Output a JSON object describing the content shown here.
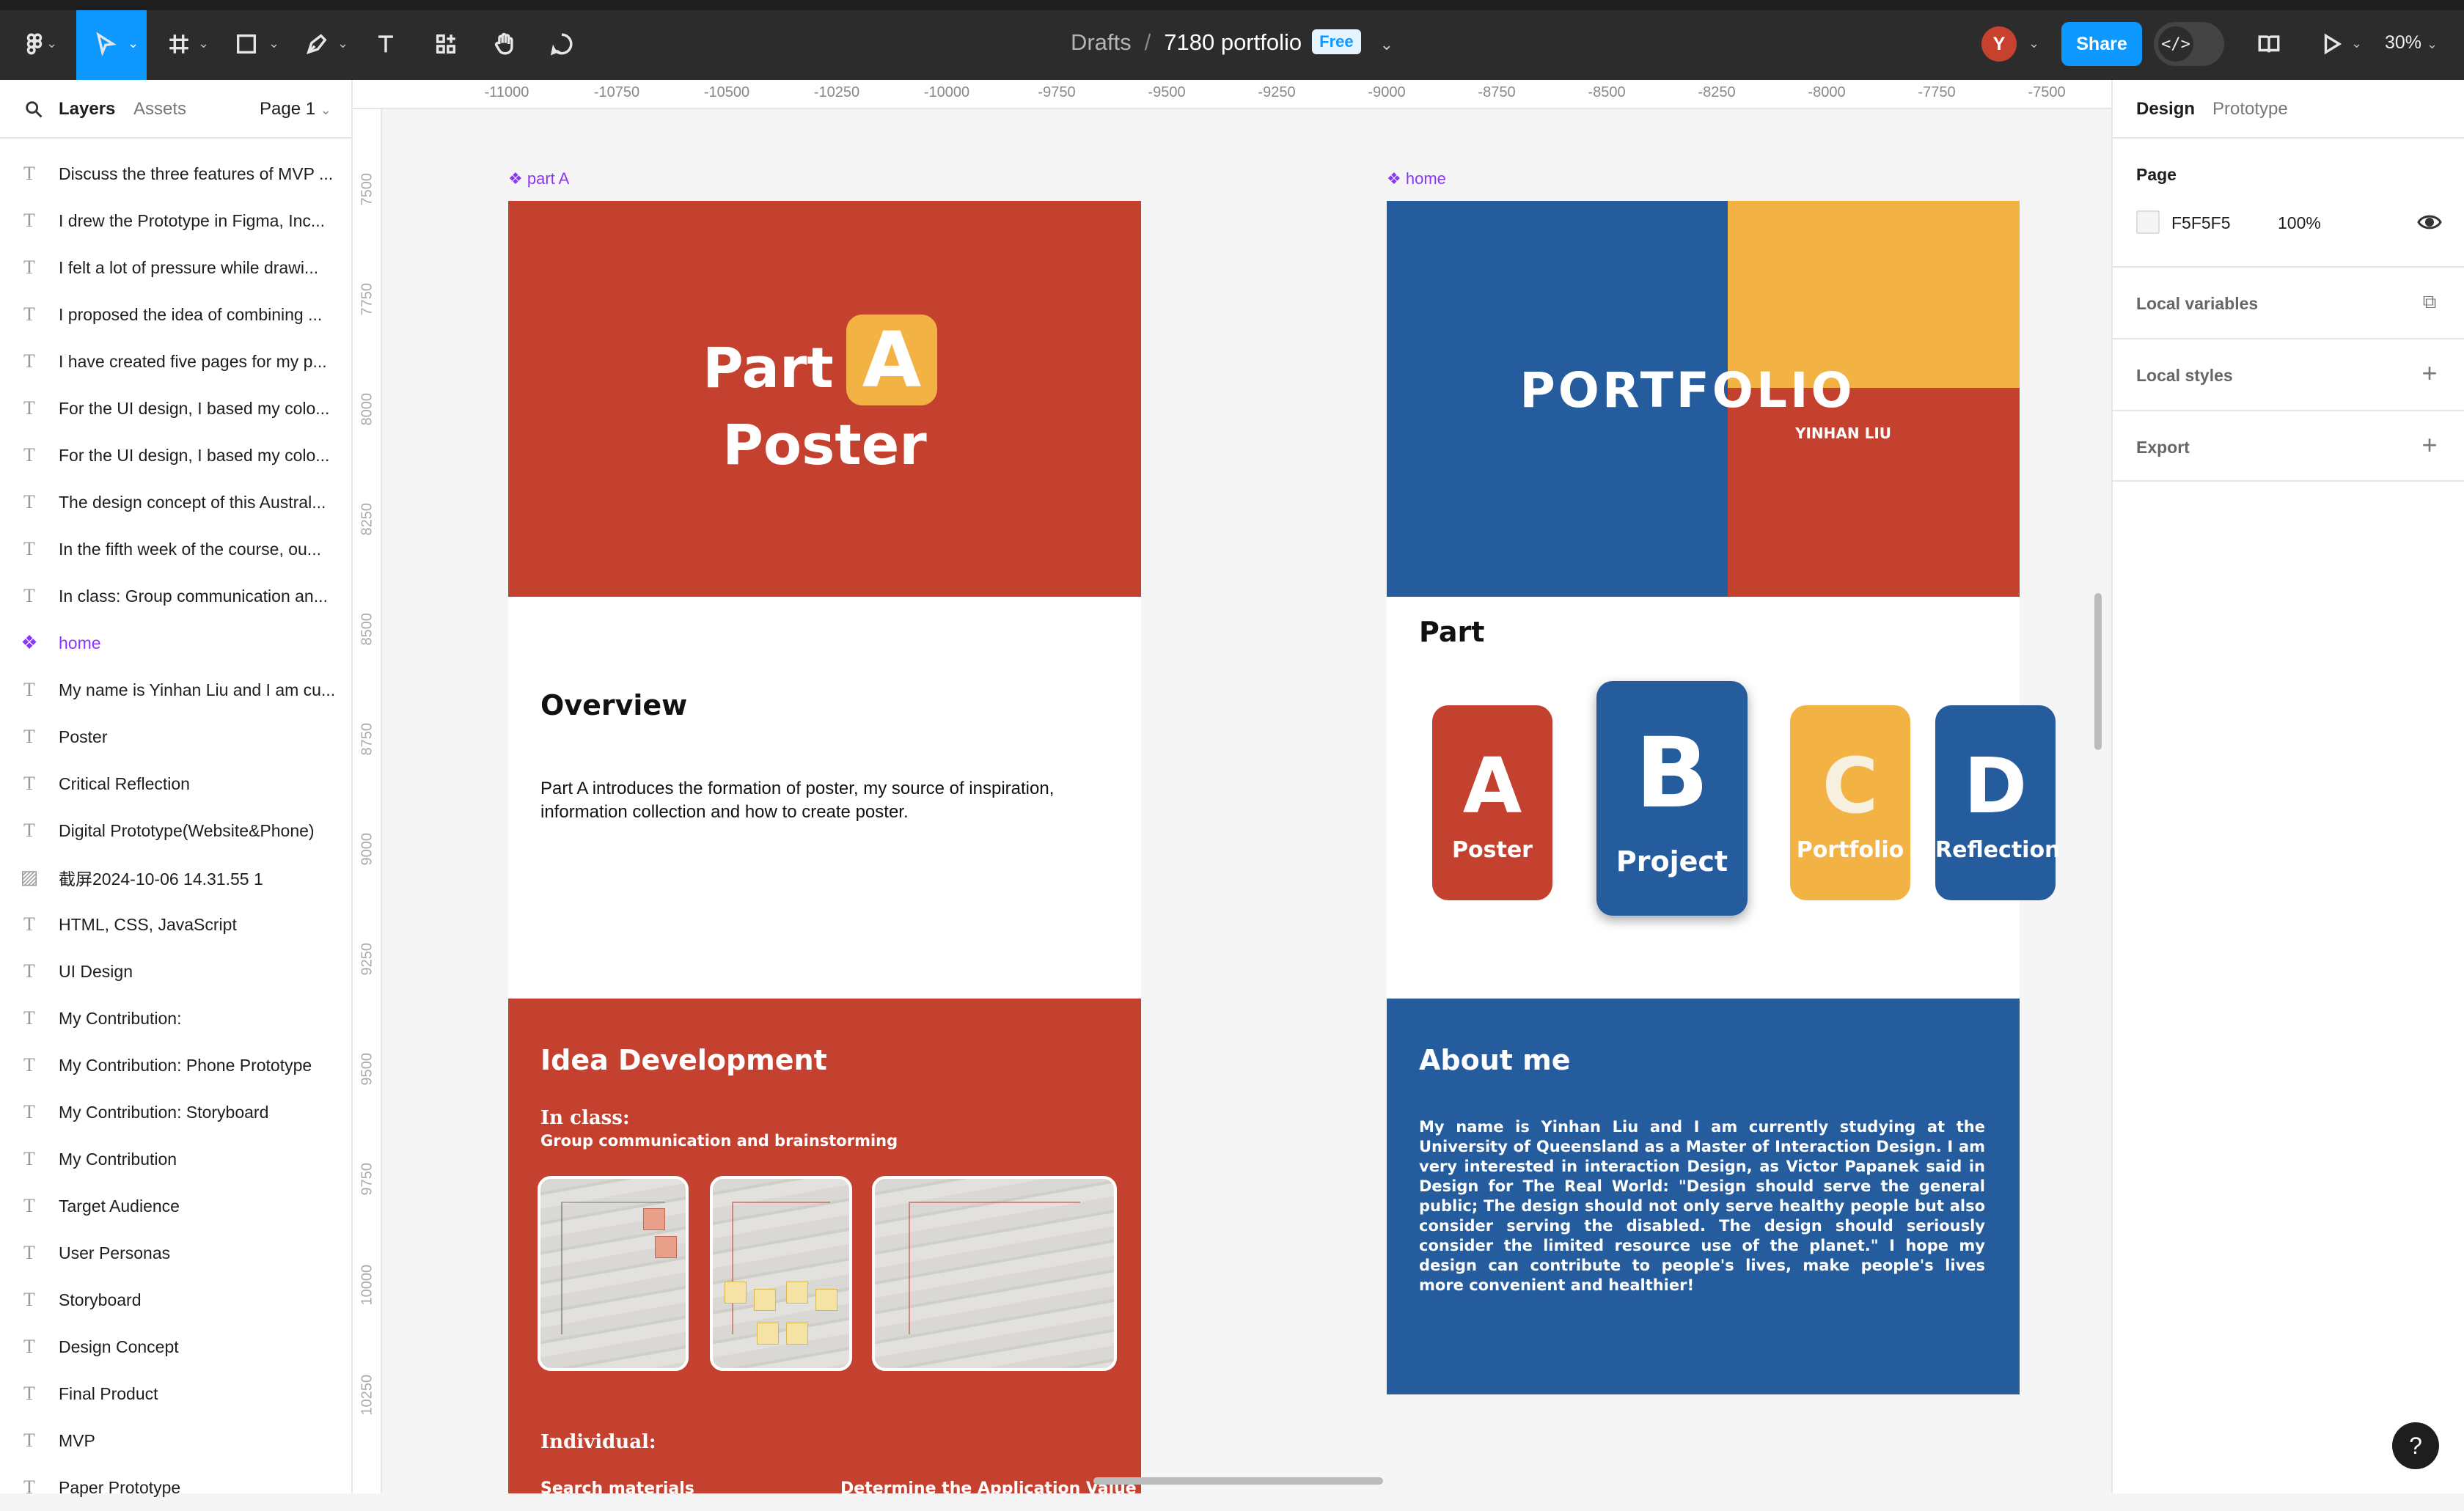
{
  "topbar": {
    "drafts": "Drafts",
    "separator": "/",
    "file_name": "7180 portfolio",
    "plan_badge": "Free",
    "avatar_initial": "Y",
    "share_label": "Share",
    "zoom": "30%",
    "tools": [
      "main-menu-icon",
      "move-icon",
      "frame-icon",
      "rectangle-icon",
      "pen-icon",
      "text-icon",
      "actions-icon",
      "hand-icon",
      "comment-icon"
    ]
  },
  "left_panel": {
    "tab_layers": "Layers",
    "tab_assets": "Assets",
    "page": "Page 1",
    "layers": [
      {
        "name": "Discuss the three features of MVP ...",
        "type": "text"
      },
      {
        "name": "I drew the Prototype in Figma, Inc...",
        "type": "text"
      },
      {
        "name": "I felt a lot of pressure while drawi...",
        "type": "text"
      },
      {
        "name": "I proposed the idea of combining ...",
        "type": "text"
      },
      {
        "name": "I have created five pages for my p...",
        "type": "text"
      },
      {
        "name": "For the UI design, I based my colo...",
        "type": "text"
      },
      {
        "name": "For the UI design, I based my colo...",
        "type": "text"
      },
      {
        "name": "The design concept of this Austral...",
        "type": "text"
      },
      {
        "name": "In the fifth week of the course, ou...",
        "type": "text"
      },
      {
        "name": "In class: Group communication an...",
        "type": "text"
      },
      {
        "name": "home",
        "type": "component"
      },
      {
        "name": "My name is Yinhan Liu and I am cu...",
        "type": "text"
      },
      {
        "name": "Poster",
        "type": "text"
      },
      {
        "name": "Critical Reflection",
        "type": "text"
      },
      {
        "name": "Digital Prototype(Website&Phone)",
        "type": "text"
      },
      {
        "name": "截屏2024-10-06 14.31.55 1",
        "type": "image"
      },
      {
        "name": "HTML, CSS, JavaScript",
        "type": "text"
      },
      {
        "name": "UI Design",
        "type": "text"
      },
      {
        "name": "My Contribution:",
        "type": "text"
      },
      {
        "name": "My Contribution: Phone Prototype",
        "type": "text"
      },
      {
        "name": "My Contribution: Storyboard",
        "type": "text"
      },
      {
        "name": "My Contribution",
        "type": "text"
      },
      {
        "name": "Target Audience",
        "type": "text"
      },
      {
        "name": "User Personas",
        "type": "text"
      },
      {
        "name": "Storyboard",
        "type": "text"
      },
      {
        "name": "Design Concept",
        "type": "text"
      },
      {
        "name": "Final Product",
        "type": "text"
      },
      {
        "name": "MVP",
        "type": "text"
      },
      {
        "name": "Paper Prototype",
        "type": "text"
      }
    ]
  },
  "right_panel": {
    "tab_design": "Design",
    "tab_prototype": "Prototype",
    "page_heading": "Page",
    "page_color_hex": "F5F5F5",
    "page_color": "#F5F5F5",
    "page_opacity": "100%",
    "sections": [
      "Local variables",
      "Local styles",
      "Export"
    ]
  },
  "rulers": {
    "top": [
      "-11000",
      "-10750",
      "-10500",
      "-10250",
      "-10000",
      "-9750",
      "-9500",
      "-9250",
      "-9000",
      "-8750",
      "-8500",
      "-8250",
      "-8000",
      "-7750",
      "-7500"
    ],
    "left": [
      "7500",
      "7750",
      "8000",
      "8250",
      "8500",
      "8750",
      "9000",
      "9250",
      "9500",
      "9750",
      "10000",
      "10250"
    ]
  },
  "canvas": {
    "part_a": {
      "frame_label": "part A",
      "title_part": "Part",
      "title_letter": "A",
      "title_poster": "Poster",
      "overview_heading": "Overview",
      "overview_text": "Part A introduces the formation of poster, my source of inspiration, information collection and how to create poster.",
      "idea_heading": "Idea Development",
      "in_class_heading": "In class:",
      "in_class_sub": "Group communication and brainstorming",
      "individual_heading": "Individual:",
      "search_materials": "Search materials",
      "determine_value": "Determine the Application Value"
    },
    "home": {
      "frame_label": "home",
      "portfolio_title": "PORTFOLIO",
      "author": "YINHAN LIU",
      "part_heading": "Part",
      "cards": [
        {
          "letter": "A",
          "label": "Poster"
        },
        {
          "letter": "B",
          "label": "Project"
        },
        {
          "letter": "C",
          "label": "Portfolio"
        },
        {
          "letter": "D",
          "label": "Reflection"
        }
      ],
      "about_heading": "About me",
      "about_text": "My name is Yinhan Liu and I am currently studying at the University of Queensland as a Master of Interaction Design. I am very interested in interaction Design, as Victor Papanek said in Design for The Real World: \"Design should serve the general public; The design should not only serve healthy people but also consider serving the disabled. The design should seriously consider the limited resource use of the planet.\" I hope my design can contribute to people's lives, make people's lives more convenient and healthier!"
    }
  },
  "colors": {
    "accent": "#0d99ff",
    "poster_red": "#c5412f",
    "portfolio_blue": "#245c9e",
    "portfolio_yellow": "#f2b244"
  },
  "help": "?"
}
